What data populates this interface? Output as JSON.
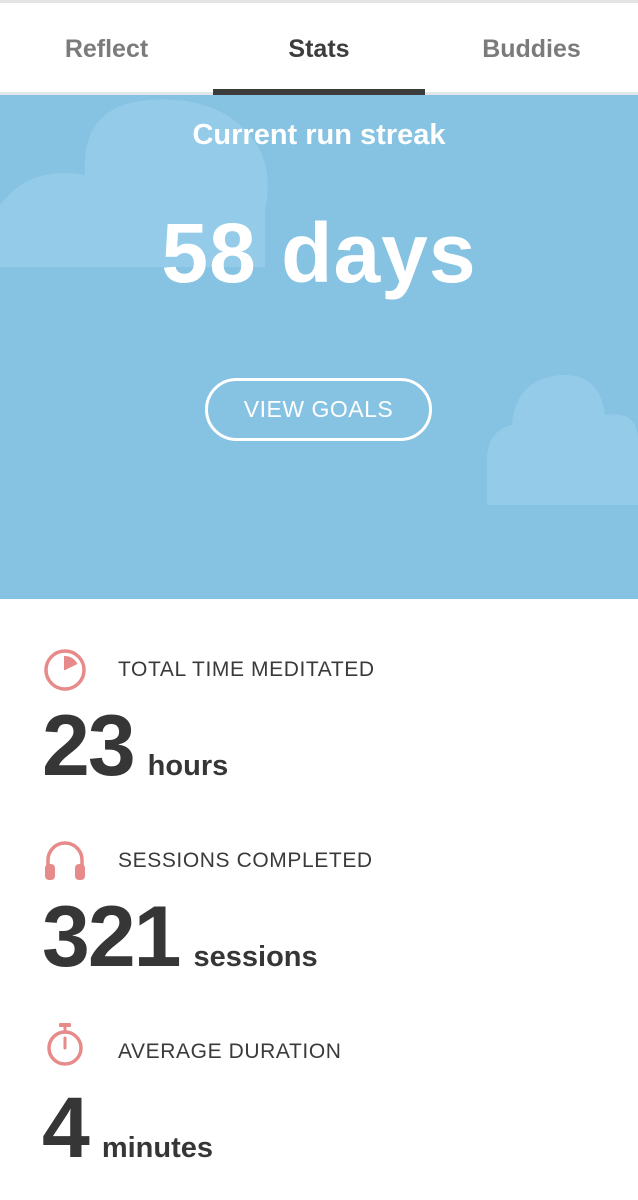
{
  "tabs": {
    "reflect": "Reflect",
    "stats": "Stats",
    "buddies": "Buddies",
    "active": "stats"
  },
  "hero": {
    "title": "Current run streak",
    "streak_value": "58 days",
    "button_label": "VIEW GOALS",
    "background_color": "#86c3e3"
  },
  "stats": {
    "total_time": {
      "icon": "pie-timer-icon",
      "label": "TOTAL TIME MEDITATED",
      "number": "23",
      "unit": "hours"
    },
    "sessions": {
      "icon": "headphones-icon",
      "label": "SESSIONS COMPLETED",
      "number": "321",
      "unit": "sessions"
    },
    "average": {
      "icon": "stopwatch-icon",
      "label": "AVERAGE DURATION",
      "number": "4",
      "unit": "minutes"
    }
  },
  "colors": {
    "icon_accent": "#e68a8a",
    "text_dark": "#363636"
  }
}
